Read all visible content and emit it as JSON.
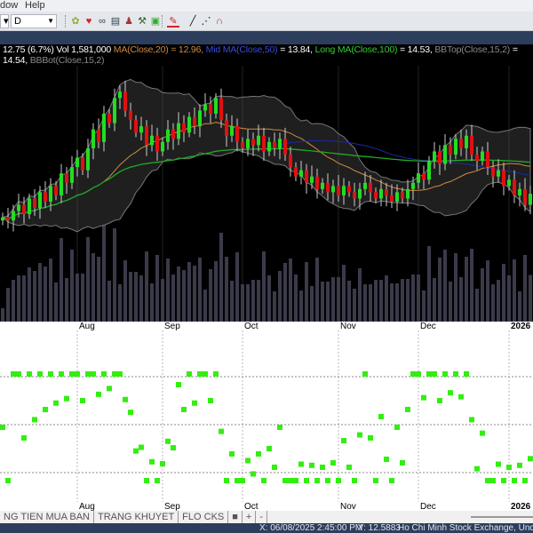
{
  "menu": {
    "items": [
      "dow",
      "Help"
    ]
  },
  "toolbar": {
    "period": "D",
    "icons": [
      "refresh-icon",
      "heart-icon",
      "binoculars-icon",
      "calendar-icon",
      "person-icon",
      "wand-icon",
      "export-icon",
      "pen-color-icon",
      "line-icon",
      "dotted-line-icon",
      "magnet-icon"
    ]
  },
  "info": {
    "price": "12.75 (6.7%) Vol 1,581,000",
    "ma20": "MA(Close,20) = 12.96,",
    "mid": "Mid MA(Close,50)",
    "mid_val": "= 13.84,",
    "long": "Long MA(Close,100)",
    "long_val": "= 14.53,",
    "bbtop": "BBTop(Close,15,2)",
    "bbtop_val": "= 14.54,",
    "bbbot": "BBBot(Close,15,2)"
  },
  "colors": {
    "up": "#22dd22",
    "down": "#e01010",
    "ma20": "#d08a40",
    "mid": "#1a2aaa",
    "long": "#22aa22",
    "bb": "#777777",
    "osc": "#33ee11"
  },
  "chart_data": {
    "type": "candlestick",
    "months": [
      {
        "label": "Aug",
        "index": 14
      },
      {
        "label": "Sep",
        "index": 30
      },
      {
        "label": "Oct",
        "index": 45
      },
      {
        "label": "Nov",
        "index": 63
      },
      {
        "label": "Dec",
        "index": 78
      },
      {
        "label": "2026",
        "index": 95
      }
    ],
    "ylim": [
      11.0,
      16.8
    ],
    "closes": [
      12.0,
      11.9,
      12.2,
      12.4,
      12.1,
      12.6,
      12.3,
      12.8,
      12.5,
      13.0,
      12.7,
      13.4,
      13.1,
      13.6,
      13.9,
      13.5,
      14.2,
      14.8,
      14.4,
      15.3,
      15.0,
      15.8,
      16.0,
      15.4,
      15.1,
      14.7,
      14.9,
      14.3,
      14.6,
      14.1,
      14.4,
      14.8,
      14.5,
      15.0,
      14.7,
      15.2,
      14.9,
      15.4,
      15.6,
      15.3,
      15.8,
      15.1,
      14.6,
      14.9,
      14.4,
      14.2,
      14.5,
      14.3,
      14.6,
      14.1,
      14.4,
      14.2,
      14.5,
      14.0,
      13.6,
      13.3,
      13.5,
      13.1,
      13.3,
      12.9,
      13.1,
      12.8,
      13.0,
      12.7,
      13.0,
      12.8,
      12.6,
      12.9,
      13.1,
      12.8,
      12.6,
      12.9,
      12.7,
      12.5,
      12.8,
      12.6,
      12.9,
      13.1,
      13.4,
      13.2,
      13.8,
      14.1,
      13.7,
      14.3,
      14.0,
      14.5,
      14.2,
      14.6,
      14.0,
      13.8,
      14.1,
      13.6,
      13.3,
      13.5,
      13.0,
      13.2,
      12.7,
      12.9,
      12.4,
      12.75
    ]
  },
  "tabs": [
    "NG TIEN MUA BAN",
    "TRANG KHUYET",
    "FLO CKS"
  ],
  "status": {
    "x": "X: 06/08/2025 2:45:00 PM",
    "y": "Y: 12.5883",
    "exchange": "Ho Chi Minh Stock Exchange, Undefin"
  }
}
